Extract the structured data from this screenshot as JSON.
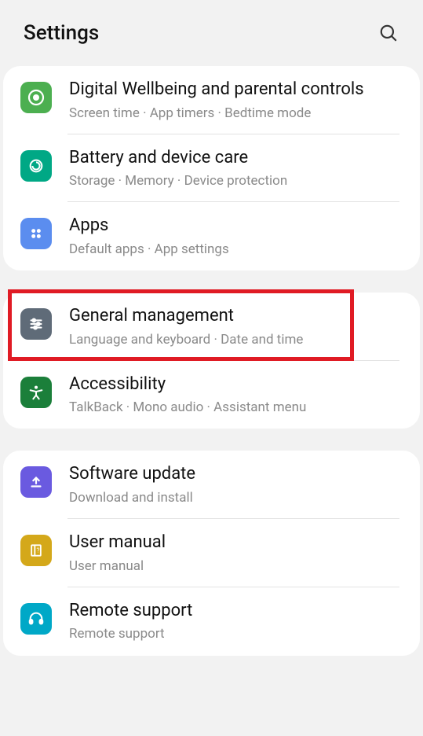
{
  "header": {
    "title": "Settings",
    "icons": {
      "search": "search-icon"
    }
  },
  "groups": [
    {
      "items": [
        {
          "id": "digital-wellbeing",
          "title": "Digital Wellbeing and parental controls",
          "subtitle": "Screen time  ·  App timers  ·  Bedtime mode",
          "icon_bg": "#4caf50",
          "icon": "heart-circle-icon"
        },
        {
          "id": "battery-device-care",
          "title": "Battery and device care",
          "subtitle": "Storage  ·  Memory  ·  Device protection",
          "icon_bg": "#00a885",
          "icon": "device-care-icon"
        },
        {
          "id": "apps",
          "title": "Apps",
          "subtitle": "Default apps  ·  App settings",
          "icon_bg": "#5b8def",
          "icon": "apps-grid-icon"
        }
      ]
    },
    {
      "items": [
        {
          "id": "general-management",
          "title": "General management",
          "subtitle": "Language and keyboard  ·  Date and time",
          "icon_bg": "#5f6b78",
          "icon": "sliders-icon",
          "highlighted": true
        },
        {
          "id": "accessibility",
          "title": "Accessibility",
          "subtitle": "TalkBack  ·  Mono audio  ·  Assistant menu",
          "icon_bg": "#1b7f3a",
          "icon": "accessibility-icon"
        }
      ]
    },
    {
      "items": [
        {
          "id": "software-update",
          "title": "Software update",
          "subtitle": "Download and install",
          "icon_bg": "#6a5ae0",
          "icon": "update-icon"
        },
        {
          "id": "user-manual",
          "title": "User manual",
          "subtitle": "User manual",
          "icon_bg": "#d4a81a",
          "icon": "manual-icon"
        },
        {
          "id": "remote-support",
          "title": "Remote support",
          "subtitle": "Remote support",
          "icon_bg": "#00a8c7",
          "icon": "headset-icon"
        }
      ]
    }
  ]
}
